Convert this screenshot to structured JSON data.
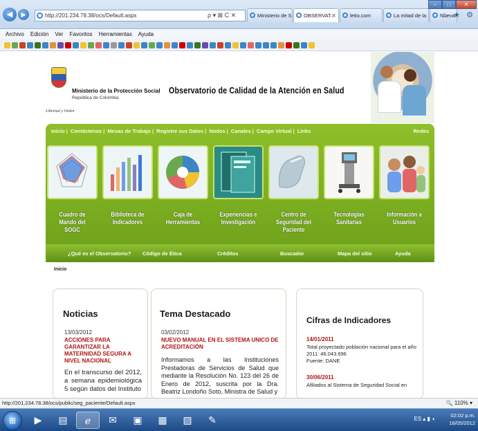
{
  "browser": {
    "address": "http://201.234.78.38/ocs/Default.aspx",
    "address_controls": "ρ ▾ ⊠ C ✕",
    "tabs": [
      {
        "label": "Ministerio de S...",
        "active": false
      },
      {
        "label": "OBSERVAT...",
        "active": true
      },
      {
        "label": "letio.com",
        "active": false
      },
      {
        "label": "La mitad de la ...",
        "active": false
      },
      {
        "label": "Nueva pestaña",
        "active": false
      }
    ],
    "window_controls": {
      "minimize": "–",
      "maximize": "□",
      "close": "✕"
    },
    "right_icons": "⌂ ★ ⚙",
    "menu": [
      "Archivo",
      "Edición",
      "Ver",
      "Favoritos",
      "Herramientas",
      "Ayuda"
    ],
    "status_url": "http://201.234.78.38/ocs/public/seg_paciente/Default.aspx",
    "zoom": "110%"
  },
  "site": {
    "ministry": "Ministerio de la Protección Social",
    "republic": "República de Colombia",
    "motto": "Libertad y Orden",
    "title": "Observatorio de Calidad de la Atención en Salud",
    "top_nav": [
      "Inicio",
      "Contáctenos",
      "Mesas de Trabajo",
      "Registre sus Datos",
      "Nodos",
      "Canales",
      "Campo Virtual",
      "Links"
    ],
    "top_nav_right": "Redes",
    "tiles": [
      {
        "label": "Cuadro de Mando del SOGC",
        "icon": "radar-chart-icon"
      },
      {
        "label": "Biblioteca de Indicadores",
        "icon": "bar-chart-icon"
      },
      {
        "label": "Caja de Herramientas",
        "icon": "pie-chart-icon"
      },
      {
        "label": "Experiencias e Investigación",
        "icon": "book-icon"
      },
      {
        "label": "Centro de Seguridad del Paciente",
        "icon": "glove-icon"
      },
      {
        "label": "Tecnologías Sanitarias",
        "icon": "medical-equipment-icon"
      },
      {
        "label": "Información a Usuarios",
        "icon": "people-icon"
      }
    ],
    "sub_nav": [
      "¿Qué es el Observatorio?",
      "Código de Ética",
      "Créditos",
      "Buscador",
      "Mapa del sitio",
      "Ayuda"
    ],
    "breadcrumb": "Inicio"
  },
  "news": {
    "title": "Noticias",
    "date": "13/03/2012",
    "headline": "ACCIONES PARA GARANTIZAR LA MATERNIDAD SEGURA A NIVEL NACIONAL",
    "text": "En el transcurso del 2012, a semana epidemiológica 5 según datos del Instituto"
  },
  "featured": {
    "title": "Tema Destacado",
    "date": "03/02/2012",
    "headline": "NUEVO MANUAL EN EL SISTEMA UNICO DE ACREDITACIÓN",
    "text": "Informamos a las Instituciones Prestadoras de Servicios de Salud que mediante la Resolución No. 123 del 26 de Enero de 2012, suscrita por la Dra. Beatriz Londoño Soto, Ministra de Salud y"
  },
  "indicators": {
    "title": "Cifras de Indicadores",
    "items": [
      {
        "date": "14/01/2011",
        "text": "Total proyectado población nacional para el año 2011: 46.043.696",
        "source": "Fuente: DANE"
      },
      {
        "date": "30/06/2011",
        "text": "Afiliados al Sistema de Seguridad Social en"
      }
    ]
  },
  "taskbar": {
    "language": "ES",
    "time": "02:02 p.m.",
    "date": "16/05/2012"
  }
}
